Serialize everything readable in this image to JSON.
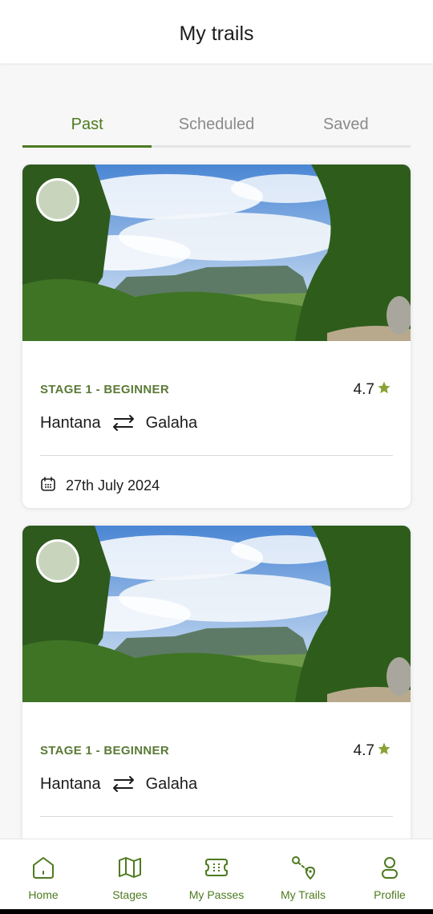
{
  "header": {
    "title": "My trails"
  },
  "tabs": [
    {
      "label": "Past",
      "active": true
    },
    {
      "label": "Scheduled",
      "active": false
    },
    {
      "label": "Saved",
      "active": false
    }
  ],
  "trails": [
    {
      "stage": "STAGE 1 - BEGINNER",
      "rating": "4.7",
      "from": "Hantana",
      "to": "Galaha",
      "date": "27th July 2024"
    },
    {
      "stage": "STAGE 1 - BEGINNER",
      "rating": "4.7",
      "from": "Hantana",
      "to": "Galaha"
    }
  ],
  "nav": [
    {
      "label": "Home",
      "icon": "home-icon"
    },
    {
      "label": "Stages",
      "icon": "map-icon"
    },
    {
      "label": "My Passes",
      "icon": "ticket-icon"
    },
    {
      "label": "My Trails",
      "icon": "route-icon"
    },
    {
      "label": "Profile",
      "icon": "user-icon"
    }
  ],
  "colors": {
    "accent": "#4d7a1f",
    "stage_label": "#5b7a36",
    "star": "#8aa234"
  }
}
